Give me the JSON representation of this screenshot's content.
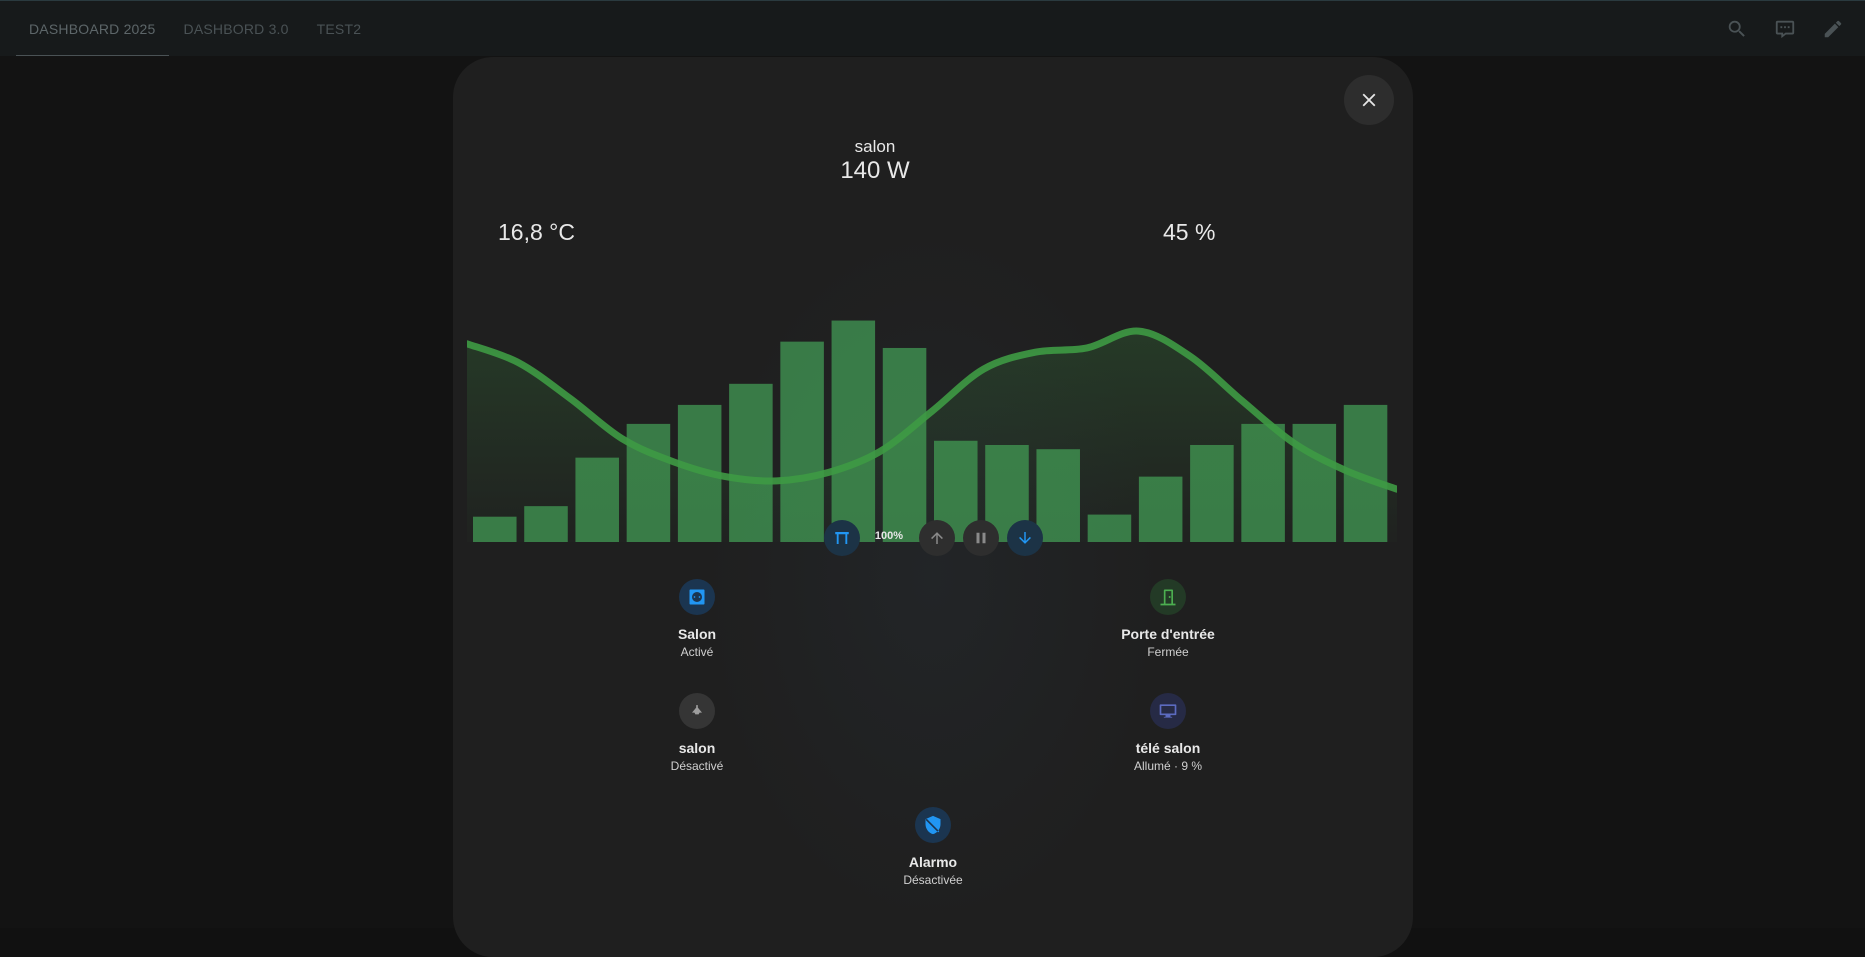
{
  "topbar": {
    "tabs": [
      {
        "label": "DASHBOARD 2025",
        "active": true
      },
      {
        "label": "DASHBORD 3.0",
        "active": false
      },
      {
        "label": "TEST2",
        "active": false
      }
    ],
    "icons": [
      "search-icon",
      "assist-icon",
      "edit-icon"
    ]
  },
  "dialog": {
    "close_icon": "close-icon",
    "room_name": "salon",
    "power": "140 W",
    "temperature": "16,8 °C",
    "humidity": "45 %"
  },
  "chart_data": {
    "type": "bar",
    "bars": {
      "values": [
        12,
        17,
        40,
        56,
        65,
        75,
        95,
        105,
        92,
        48,
        46,
        44,
        13,
        31,
        46,
        56,
        56,
        65
      ],
      "ylim": [
        0,
        110
      ],
      "color": "#3e8c4f"
    },
    "line": {
      "values": [
        94,
        85,
        68,
        49,
        38,
        31,
        29,
        33,
        43,
        62,
        82,
        90,
        92,
        100,
        88,
        67,
        47,
        34,
        25
      ],
      "ylim": [
        0,
        110
      ],
      "color": "#3e9a44"
    }
  },
  "cover_controls": {
    "cover_icon": "garage-icon",
    "position": "100%",
    "up_icon": "arrow-up-icon",
    "stop_icon": "pause-icon",
    "down_icon": "arrow-down-icon",
    "accent": "#2196f3"
  },
  "tiles": {
    "salon_socket": {
      "name": "Salon",
      "state": "Activé",
      "icon": "power-socket-icon",
      "color": "#1e88e5"
    },
    "front_door": {
      "name": "Porte d'entrée",
      "state": "Fermée",
      "icon": "door-closed-icon",
      "color": "#4caf50"
    },
    "salon_fan": {
      "name": "salon",
      "state": "Désactivé",
      "icon": "ceiling-fan-icon",
      "color": "#9e9e9e"
    },
    "tv": {
      "name": "télé salon",
      "state": "Allumé · 9 %",
      "icon": "television-icon",
      "color": "#3f51b5"
    },
    "alarm": {
      "name": "Alarmo",
      "state": "Désactivée",
      "icon": "shield-off-icon",
      "color": "#1e88e5"
    }
  }
}
